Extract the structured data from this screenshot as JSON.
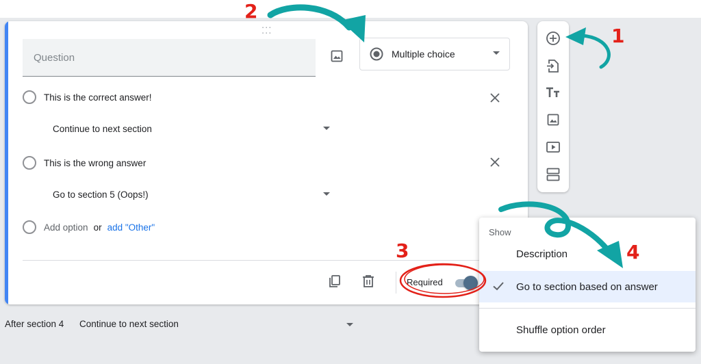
{
  "question": {
    "placeholder": "Question",
    "type_label": "Multiple choice"
  },
  "options": [
    {
      "label": "This is the correct answer!",
      "destination": "Continue to next section"
    },
    {
      "label": "This is the wrong answer",
      "destination": "Go to section 5 (Oops!)"
    }
  ],
  "add_option": {
    "label": "Add option",
    "or": "or",
    "other": "add \"Other\""
  },
  "footer": {
    "required_label": "Required",
    "required_on": true
  },
  "after_section": {
    "label": "After section 4",
    "value": "Continue to next section"
  },
  "toolbar": {
    "items": [
      "add-question-icon",
      "import-questions-icon",
      "add-title-icon",
      "add-image-icon",
      "add-video-icon",
      "add-section-icon"
    ]
  },
  "menu": {
    "header": "Show",
    "items": [
      {
        "label": "Description",
        "checked": false
      },
      {
        "label": "Go to section based on answer",
        "checked": true
      },
      {
        "label": "Shuffle option order",
        "checked": false
      }
    ]
  },
  "annotations": {
    "n1": "1",
    "n2": "2",
    "n3": "3",
    "n4": "4"
  },
  "colors": {
    "accent": "#4285f4",
    "link": "#1a73e8",
    "annotation_red": "#e32119",
    "arrow_teal": "#12a4a4",
    "menu_selected": "#e8f0fe"
  }
}
